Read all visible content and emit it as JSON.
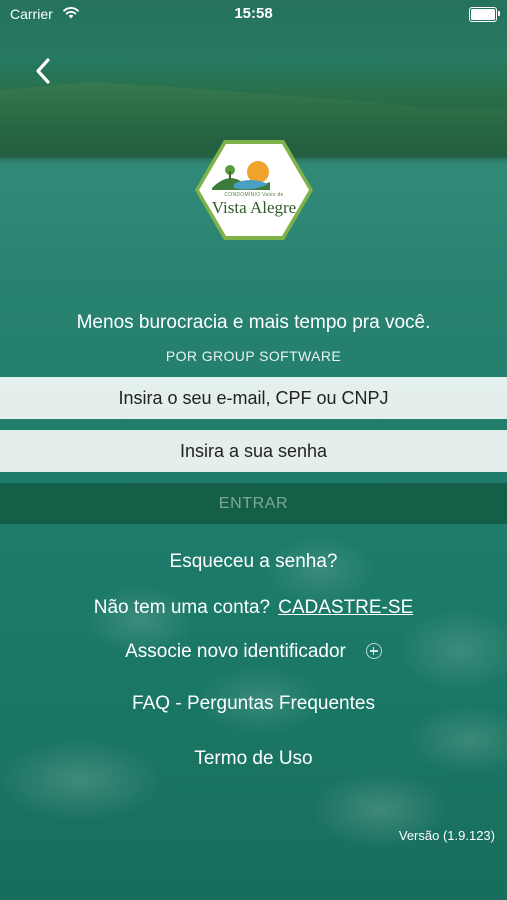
{
  "status_bar": {
    "carrier": "Carrier",
    "time": "15:58"
  },
  "logo": {
    "small_text": "CONDOMÍNIO Vales de",
    "main_text": "Vista Alegre"
  },
  "tagline": "Menos burocracia e mais tempo pra você.",
  "subtitle": "POR GROUP SOFTWARE",
  "email_field": {
    "placeholder": "Insira o seu e-mail, CPF ou CNPJ"
  },
  "password_field": {
    "placeholder": "Insira a sua senha"
  },
  "enter_button": "ENTRAR",
  "links": {
    "forgot_password": "Esqueceu a senha?",
    "no_account": "Não tem uma conta?",
    "signup": "CADASTRE-SE",
    "associate": "Associe novo identificador",
    "faq": "FAQ - Perguntas Frequentes",
    "terms": "Termo de Uso"
  },
  "version": "Versão (1.9.123)",
  "colors": {
    "background": "#1f7b68",
    "enter_button": "#12553e",
    "logo_border": "#7fb34a"
  }
}
